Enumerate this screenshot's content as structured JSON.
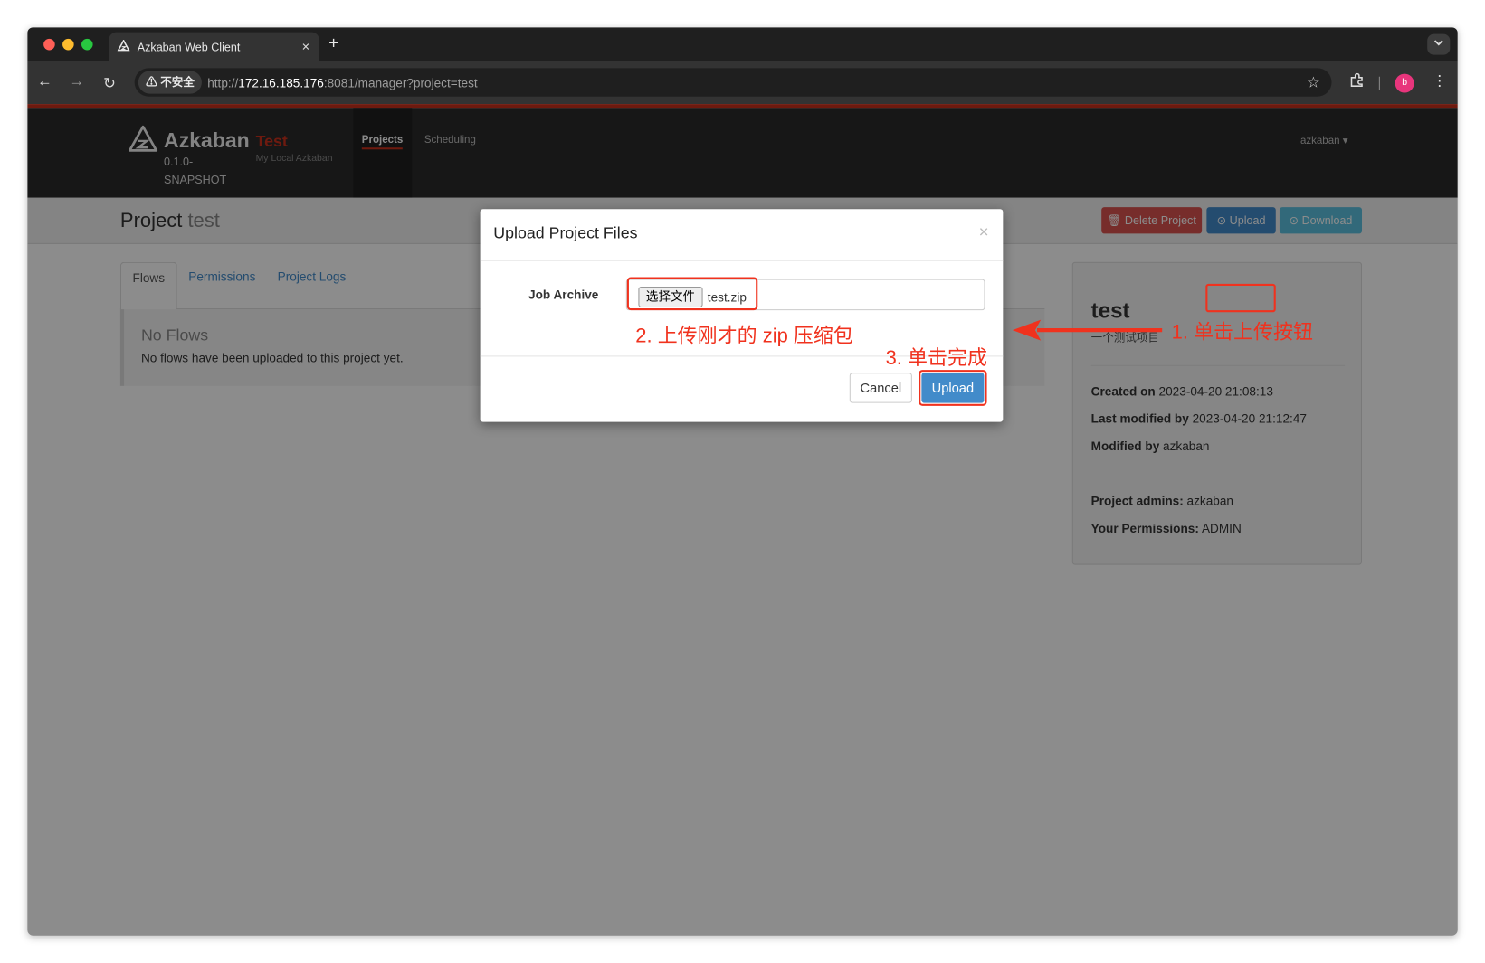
{
  "browser": {
    "tab_title": "Azkaban Web Client",
    "tab_close": "×",
    "new_tab": "+",
    "security_label": "⚠ 不安全",
    "url_scheme": "http://",
    "url_host": "172.16.185.176",
    "url_rest": ":8081/manager?project=test",
    "profile_initial": "b"
  },
  "navbar": {
    "brand": "Azkaban",
    "version": "0.1.0-SNAPSHOT",
    "env_name": "Test",
    "env_desc": "My Local Azkaban",
    "projects": "Projects",
    "scheduling": "Scheduling",
    "user": "azkaban ▾"
  },
  "project": {
    "title_prefix": "Project",
    "name": "test",
    "delete_button": "Delete Project",
    "upload_button": "Upload",
    "download_button": "Download"
  },
  "tabs": [
    {
      "label": "Flows"
    },
    {
      "label": "Permissions"
    },
    {
      "label": "Project Logs"
    }
  ],
  "flows": {
    "empty_title": "No Flows",
    "empty_text": "No flows have been uploaded to this project yet."
  },
  "side_panel": {
    "name": "test",
    "description": "一个测试项目",
    "created_label": "Created on",
    "created_value": "2023-04-20 21:08:13",
    "modified_label": "Last modified by",
    "modified_value": "2023-04-20 21:12:47",
    "modified_by_label": "Modified by",
    "modified_by_value": "azkaban",
    "admins_label": "Project admins:",
    "admins_value": "azkaban",
    "permissions_label": "Your Permissions:",
    "permissions_value": "ADMIN"
  },
  "modal": {
    "title": "Upload Project Files",
    "close": "×",
    "field_label": "Job Archive",
    "file_button": "选择文件",
    "file_name": "test.zip",
    "cancel": "Cancel",
    "upload": "Upload"
  },
  "annotations": {
    "step1": "1. 单击上传按钮",
    "step2": "2. 上传刚才的 zip 压缩包",
    "step3": "3. 单击完成"
  },
  "colors": {
    "annotation_red": "#f0321e",
    "azkaban_red": "#c9301c",
    "primary_blue": "#428bca",
    "danger_red": "#d9534f",
    "info_cyan": "#5bc0de"
  }
}
